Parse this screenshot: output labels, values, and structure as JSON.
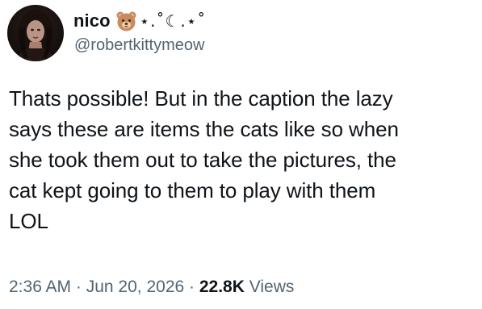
{
  "author": {
    "display_name": "nico",
    "name_decoration": "⋆.˚☾.⋆˚",
    "emoji": "bear-face-icon",
    "handle": "@robertkittymeow"
  },
  "tweet": {
    "text": "Thats possible! But in the caption the lazy\nsays these are items the cats like so when\nshe took them out to take the pictures, the\ncat kept going to them to play with them\nLOL"
  },
  "meta": {
    "time": "2:36 AM",
    "sep1": " · ",
    "date": "Jun 20, 2026",
    "sep2": " · ",
    "views_count": "22.8K",
    "views_label": " Views"
  },
  "colors": {
    "text": "#0f1419",
    "secondary": "#536471",
    "background": "#ffffff"
  }
}
